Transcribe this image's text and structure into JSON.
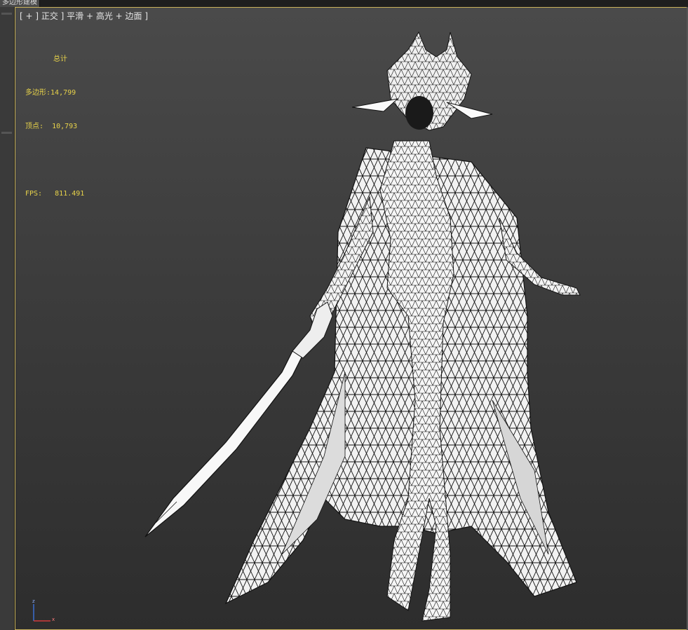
{
  "window": {
    "tab_label": "多边形建模"
  },
  "viewport": {
    "label_parts": [
      "[ + ]",
      "[ 正交 ]",
      "[ 平滑 + 高光 + 边面 ]"
    ],
    "label_text": "[ + ] 正交 ] 平滑 + 高光 + 边面 ]",
    "stats": {
      "header": "总计",
      "polys_label": "多边形:",
      "polys_value": "14,799",
      "verts_label": "顶点:",
      "verts_value": "10,793",
      "fps_label": "FPS:",
      "fps_value": "811.491"
    },
    "axis": {
      "z": "z",
      "x": "x"
    }
  },
  "colors": {
    "viewport_border": "#c9b25a",
    "stats_text": "#e8d34a",
    "mesh_fill": "#f2f2f2",
    "mesh_line": "#111111"
  },
  "icons": [
    "axis-gizmo-icon"
  ]
}
